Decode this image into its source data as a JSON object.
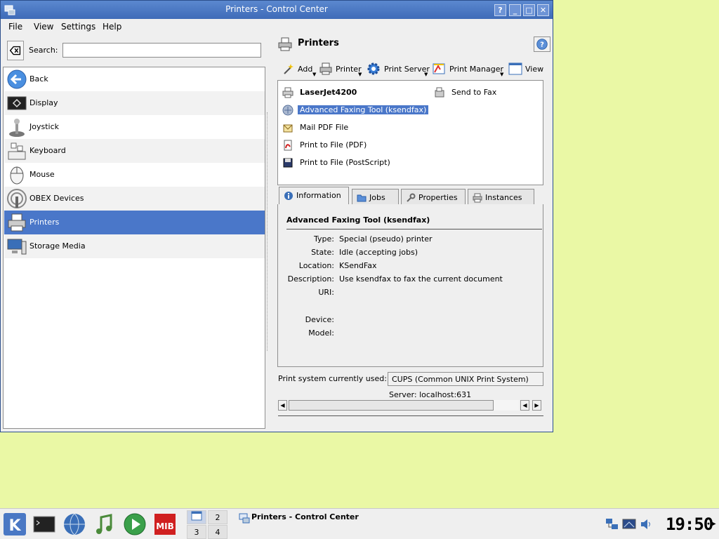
{
  "window": {
    "title": "Printers - Control Center",
    "buttons": [
      "?",
      "_",
      "□",
      "✕"
    ]
  },
  "menu": [
    "File",
    "View",
    "Settings",
    "Help"
  ],
  "search": {
    "label": "Search:",
    "value": "",
    "placeholder": ""
  },
  "modules": [
    {
      "label": "Back",
      "icon": "back-arrow-icon"
    },
    {
      "label": "Display",
      "icon": "display-icon"
    },
    {
      "label": "Joystick",
      "icon": "joystick-icon"
    },
    {
      "label": "Keyboard",
      "icon": "keyboard-icon"
    },
    {
      "label": "Mouse",
      "icon": "mouse-icon"
    },
    {
      "label": "OBEX Devices",
      "icon": "obex-icon"
    },
    {
      "label": "Printers",
      "icon": "printer-icon",
      "selected": true
    },
    {
      "label": "Storage Media",
      "icon": "storage-icon"
    }
  ],
  "panel": {
    "title": "Printers",
    "toolbar": [
      "Add",
      "Printer",
      "Print Server",
      "Print Manager",
      "View"
    ],
    "printers": [
      {
        "label": "LaserJet4200",
        "icon": "printer-icon",
        "bold": true
      },
      {
        "label": "Send to Fax",
        "icon": "fax-icon"
      },
      {
        "label": "Advanced Faxing Tool (ksendfax)",
        "icon": "faxing-tool-icon",
        "selected": true
      },
      {
        "label": "Mail PDF File",
        "icon": "mail-pdf-icon"
      },
      {
        "label": "Print to File (PDF)",
        "icon": "pdf-icon"
      },
      {
        "label": "Print to File (PostScript)",
        "icon": "postscript-icon"
      }
    ],
    "tabs": [
      "Information",
      "Jobs",
      "Properties",
      "Instances"
    ],
    "info": {
      "title": "Advanced Faxing Tool (ksendfax)",
      "rows": [
        {
          "key": "Type:",
          "value": "Special (pseudo) printer"
        },
        {
          "key": "State:",
          "value": "Idle (accepting jobs)"
        },
        {
          "key": "Location:",
          "value": "KSendFax"
        },
        {
          "key": "Description:",
          "value": "Use ksendfax to fax the current document"
        },
        {
          "key": "URI:",
          "value": ""
        },
        {
          "key": "Device:",
          "value": ""
        },
        {
          "key": "Model:",
          "value": ""
        }
      ]
    },
    "system_label": "Print system currently used:",
    "system_value": "CUPS (Common UNIX Print System)",
    "server": "Server: localhost:631"
  },
  "taskbar": {
    "desktops": [
      "1",
      "2",
      "3",
      "4"
    ],
    "task": "Printers - Control Center",
    "clock": "19:50"
  },
  "colors": {
    "selection": "#4a77c9",
    "titlebar": "#4a78c4",
    "desktop": "#eaf8a5"
  }
}
